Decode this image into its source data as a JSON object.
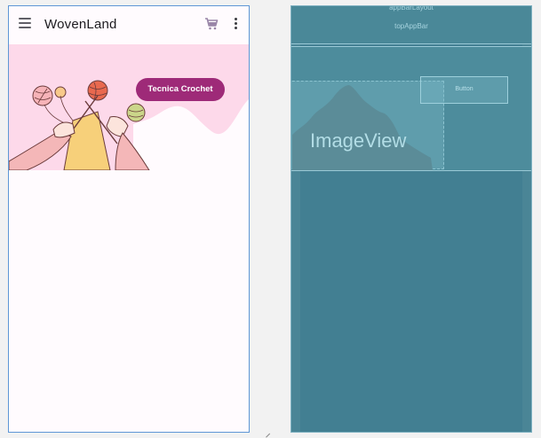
{
  "design": {
    "app_title": "WovenLand",
    "chip_label": "Tecnica Crochet",
    "icons": {
      "menu": "menu-icon",
      "cart": "cart-icon",
      "more": "more-vert-icon"
    },
    "colors": {
      "chip": "#9e2a78",
      "hero_bg": "#fdd9ea"
    }
  },
  "blueprint": {
    "appbar_layout_label": "appBarLayout",
    "top_app_bar_label": "topAppBar",
    "image_view_label": "ImageView",
    "button_label": "Button"
  }
}
